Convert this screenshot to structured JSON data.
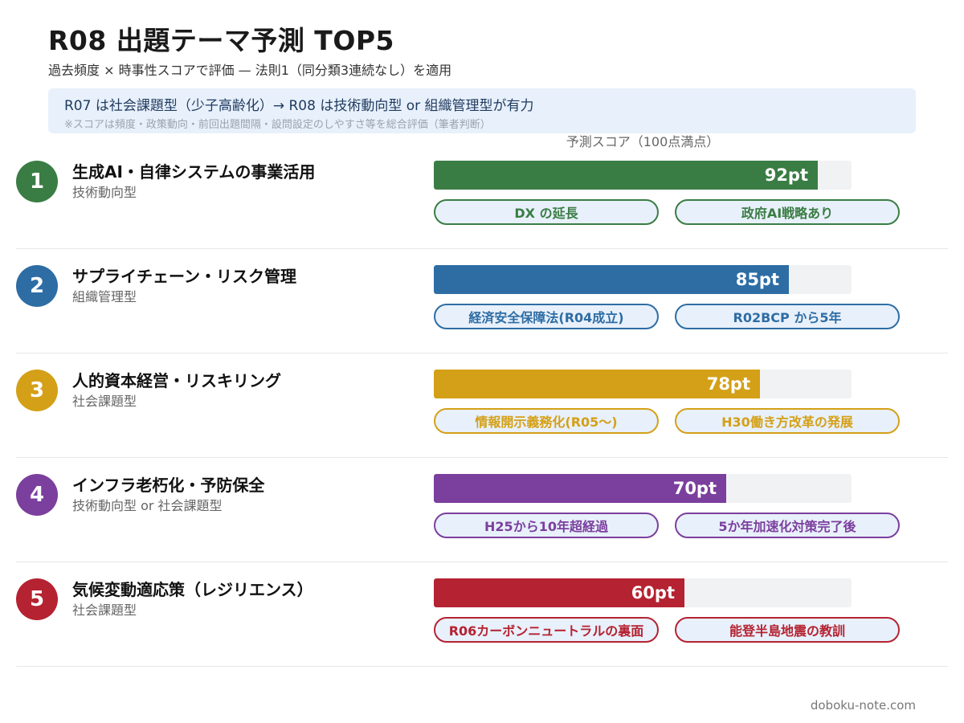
{
  "header": {
    "title": "R08 出題テーマ予測 TOP5",
    "subtitle": "過去頻度 × 時事性スコアで評価 — 法則1（同分類3連続なし）を適用"
  },
  "note": {
    "main": "R07 は社会課題型（少子高齢化）→ R08 は技術動向型 or 組織管理型が有力",
    "sub": "※スコアは頻度・政策動向・前回出題間隔・設問設定のしやすさ等を総合評価（筆者判断）"
  },
  "chart_data": {
    "type": "bar",
    "orientation": "horizontal",
    "title": "予測スコア（100点満点）",
    "xlim": [
      0,
      100
    ],
    "unit": "pt",
    "items": [
      {
        "rank": "1",
        "name": "生成AI・自律システムの事業活用",
        "category": "技術動向型",
        "value": 92,
        "value_label": "92pt",
        "color": "#3a7d44",
        "tags": [
          "DX の延長",
          "政府AI戦略あり"
        ]
      },
      {
        "rank": "2",
        "name": "サプライチェーン・リスク管理",
        "category": "組織管理型",
        "value": 85,
        "value_label": "85pt",
        "color": "#2e6da4",
        "tags": [
          "経済安全保障法(R04成立)",
          "R02BCP から5年"
        ]
      },
      {
        "rank": "3",
        "name": "人的資本経営・リスキリング",
        "category": "社会課題型",
        "value": 78,
        "value_label": "78pt",
        "color": "#d4a017",
        "tags": [
          "情報開示義務化(R05〜)",
          "H30働き方改革の発展"
        ]
      },
      {
        "rank": "4",
        "name": "インフラ老朽化・予防保全",
        "category": "技術動向型 or 社会課題型",
        "value": 70,
        "value_label": "70pt",
        "color": "#7b3f9e",
        "tags": [
          "H25から10年超経過",
          "5か年加速化対策完了後"
        ]
      },
      {
        "rank": "5",
        "name": "気候変動適応策（レジリエンス）",
        "category": "社会課題型",
        "value": 60,
        "value_label": "60pt",
        "color": "#b52231",
        "tags": [
          "R06カーボンニュートラルの裏面",
          "能登半島地震の教訓"
        ]
      }
    ]
  },
  "footer": {
    "site": "doboku-note.com"
  }
}
